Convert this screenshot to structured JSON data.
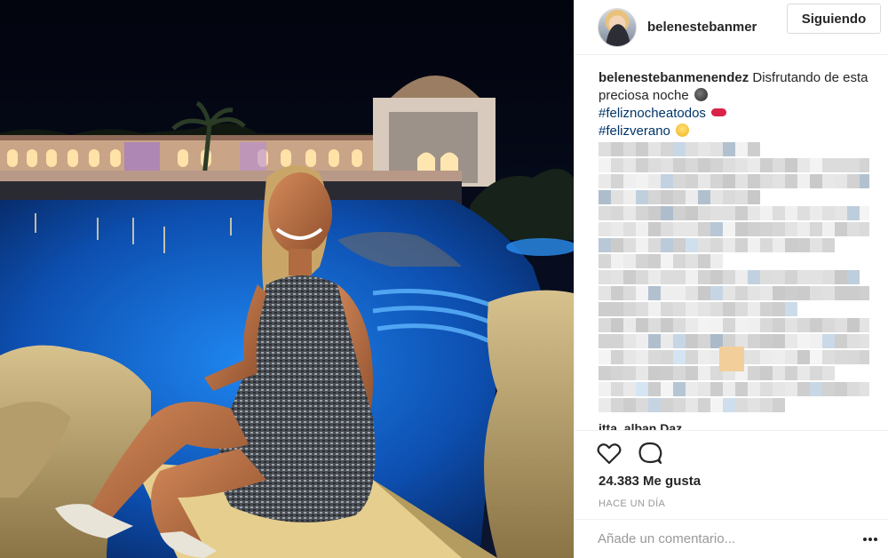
{
  "post": {
    "username": "belenestebanmenendez",
    "header_username": "belenestebanmer",
    "follow_label": "Siguiendo",
    "caption_text": "Disfrutando de esta preciosa noche",
    "hashtags": [
      "#feliznocheatodos",
      "#felizverano"
    ],
    "truncated_comment": "itta_alban Daz",
    "likes": "24.383 Me gusta",
    "time": "HACE UN DÍA",
    "comment_placeholder": "Añade un comentario..."
  },
  "icons": {
    "like": "heart-outline-icon",
    "comment": "speech-bubble-icon",
    "more": "three-dots-icon"
  },
  "colors": {
    "text": "#262626",
    "hashtag": "#003569",
    "muted": "#999999",
    "border": "#dbdbdb",
    "pool": "#1a78d8",
    "night_sky": "#050a1c"
  }
}
